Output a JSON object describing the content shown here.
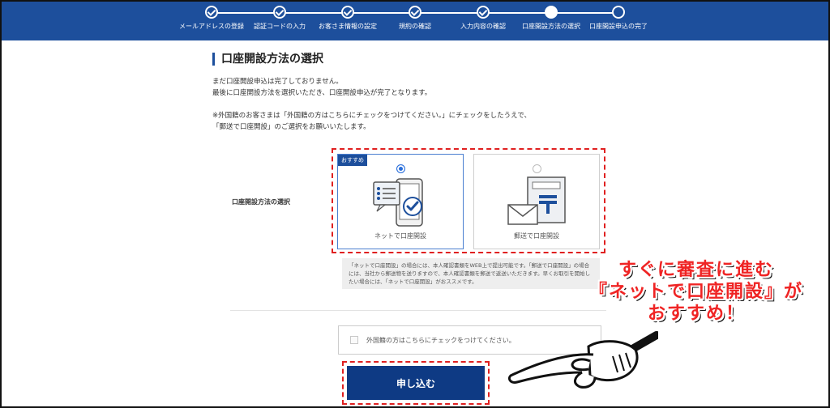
{
  "steps": [
    {
      "label": "メールアドレスの登録",
      "state": "done"
    },
    {
      "label": "認証コードの入力",
      "state": "done"
    },
    {
      "label": "お客さま情報の設定",
      "state": "done"
    },
    {
      "label": "規約の確認",
      "state": "done"
    },
    {
      "label": "入力内容の確認",
      "state": "done"
    },
    {
      "label": "口座開設方法の選択",
      "state": "current"
    },
    {
      "label": "口座開設申込の完了",
      "state": "todo"
    }
  ],
  "heading": "口座開設方法の選択",
  "intro": {
    "line1": "まだ口座開設申込は完了しておりません。",
    "line2": "最後に口座開設方法を選択いただき、口座開設申込が完了となります。",
    "line3": "※外国籍のお客さまは「外国籍の方はこちらにチェックをつけてください。」にチェックをしたうえで、",
    "line4": "「郵送で口座開設」のご選択をお願いいたします。"
  },
  "method_label": "口座開設方法の選択",
  "options": {
    "online": {
      "badge": "おすすめ",
      "label": "ネットで口座開設",
      "selected": true,
      "icon": "smartphone-check-icon"
    },
    "mail": {
      "label": "郵送で口座開設",
      "selected": false,
      "icon": "postal-mail-icon"
    }
  },
  "note": "「ネットで口座開設」の場合には、本人確認書類をWEB上で提出可能です。「郵送で口座開設」の場合には、当社から郵送物を送りますので、本人確認書類を郵送で返送いただきます。早くお取引を開始したい場合には、「ネットで口座開設」がおススメです。",
  "foreign_checkbox": "外国籍の方はこちらにチェックをつけてください。",
  "submit_label": "申し込む",
  "callout": {
    "line1": "すぐに審査に進む",
    "line2": "『ネットで口座開設』が",
    "line3": "おすすめ！"
  },
  "colors": {
    "primary": "#1d4f9c",
    "button": "#0e3a84",
    "highlight": "#e02020",
    "callout": "#ef2424"
  }
}
